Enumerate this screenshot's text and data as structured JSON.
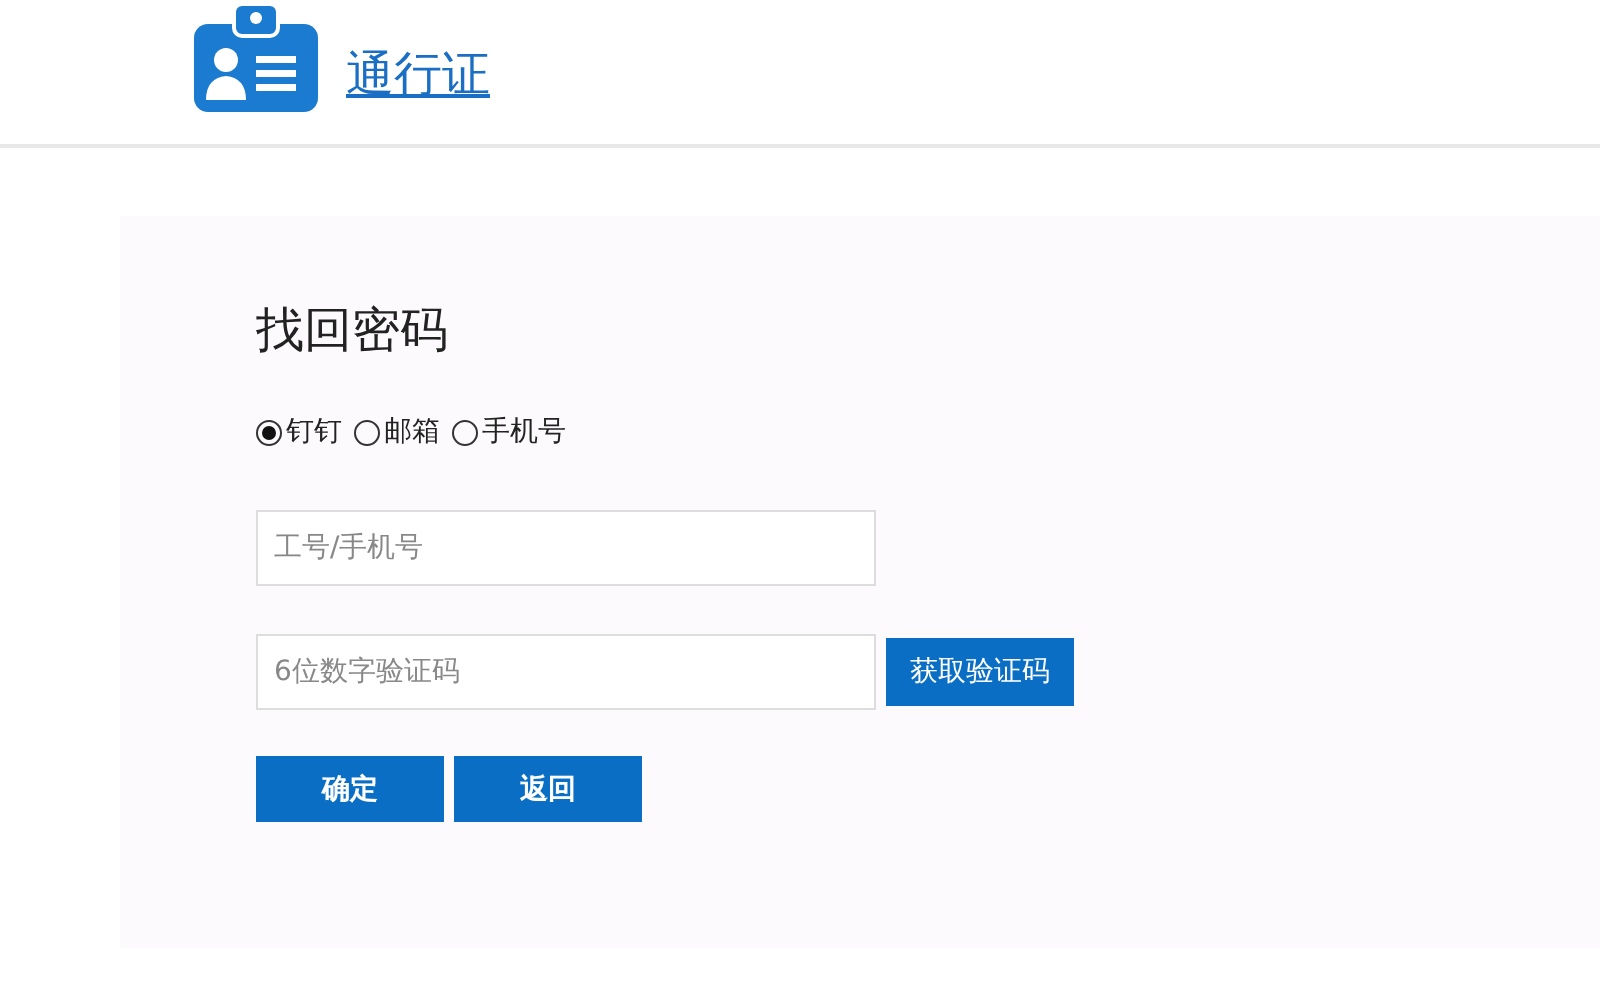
{
  "header": {
    "logo_text": "通行证"
  },
  "form": {
    "title": "找回密码",
    "methods": [
      {
        "label": "钉钉",
        "selected": true
      },
      {
        "label": "邮箱",
        "selected": false
      },
      {
        "label": "手机号",
        "selected": false
      }
    ],
    "account_field": {
      "placeholder": "工号/手机号"
    },
    "code_field": {
      "placeholder": "6位数字验证码"
    },
    "code_button": "获取验证码",
    "buttons": [
      "确定",
      "返回"
    ]
  }
}
